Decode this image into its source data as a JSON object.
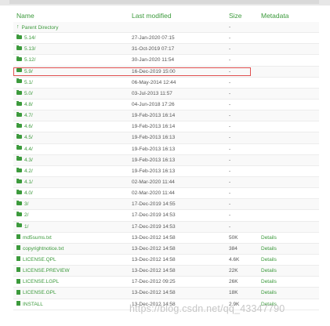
{
  "columns": {
    "name": "Name",
    "modified": "Last modified",
    "size": "Size",
    "metadata": "Metadata"
  },
  "rows": [
    {
      "icon": "up-arrow-icon",
      "name": "Parent Directory",
      "modified": "",
      "size": "-",
      "meta": ""
    },
    {
      "icon": "folder-icon",
      "name": "5.14/",
      "modified": "27-Jan-2020 07:15",
      "size": "-",
      "meta": ""
    },
    {
      "icon": "folder-icon",
      "name": "5.13/",
      "modified": "31-Oct-2019 07:17",
      "size": "-",
      "meta": ""
    },
    {
      "icon": "folder-icon",
      "name": "5.12/",
      "modified": "30-Jan-2020 11:54",
      "size": "-",
      "meta": ""
    },
    {
      "icon": "folder-icon",
      "name": "5.9/",
      "modified": "16-Dec-2019 15:00",
      "size": "-",
      "meta": ""
    },
    {
      "icon": "folder-icon",
      "name": "5.1/",
      "modified": "06-May-2014 12:44",
      "size": "-",
      "meta": ""
    },
    {
      "icon": "folder-icon",
      "name": "5.0/",
      "modified": "03-Jul-2013 11:57",
      "size": "-",
      "meta": ""
    },
    {
      "icon": "folder-icon",
      "name": "4.8/",
      "modified": "04-Jun-2018 17:26",
      "size": "-",
      "meta": ""
    },
    {
      "icon": "folder-icon",
      "name": "4.7/",
      "modified": "19-Feb-2013 16:14",
      "size": "-",
      "meta": ""
    },
    {
      "icon": "folder-icon",
      "name": "4.6/",
      "modified": "19-Feb-2013 16:14",
      "size": "-",
      "meta": ""
    },
    {
      "icon": "folder-icon",
      "name": "4.5/",
      "modified": "19-Feb-2013 16:13",
      "size": "-",
      "meta": ""
    },
    {
      "icon": "folder-icon",
      "name": "4.4/",
      "modified": "19-Feb-2013 16:13",
      "size": "-",
      "meta": ""
    },
    {
      "icon": "folder-icon",
      "name": "4.3/",
      "modified": "19-Feb-2013 16:13",
      "size": "-",
      "meta": ""
    },
    {
      "icon": "folder-icon",
      "name": "4.2/",
      "modified": "19-Feb-2013 16:13",
      "size": "-",
      "meta": ""
    },
    {
      "icon": "folder-icon",
      "name": "4.1/",
      "modified": "02-Mar-2020 11:44",
      "size": "-",
      "meta": ""
    },
    {
      "icon": "folder-icon",
      "name": "4.0/",
      "modified": "02-Mar-2020 11:44",
      "size": "-",
      "meta": ""
    },
    {
      "icon": "folder-icon",
      "name": "3/",
      "modified": "17-Dec-2019 14:55",
      "size": "-",
      "meta": ""
    },
    {
      "icon": "folder-icon",
      "name": "2/",
      "modified": "17-Dec-2019 14:53",
      "size": "-",
      "meta": ""
    },
    {
      "icon": "folder-icon",
      "name": "1/",
      "modified": "17-Dec-2019 14:53",
      "size": "-",
      "meta": ""
    },
    {
      "icon": "file-icon",
      "name": "md5sums.txt",
      "modified": "13-Dec-2012 14:58",
      "size": "50K",
      "meta": "Details"
    },
    {
      "icon": "file-icon",
      "name": "copyrightnotice.txt",
      "modified": "13-Dec-2012 14:58",
      "size": "384",
      "meta": "Details"
    },
    {
      "icon": "file-icon",
      "name": "LICENSE.QPL",
      "modified": "13-Dec-2012 14:58",
      "size": "4.6K",
      "meta": "Details"
    },
    {
      "icon": "file-icon",
      "name": "LICENSE.PREVIEW",
      "modified": "13-Dec-2012 14:58",
      "size": "22K",
      "meta": "Details"
    },
    {
      "icon": "file-icon",
      "name": "LICENSE.LGPL",
      "modified": "17-Dec-2012 09:25",
      "size": "26K",
      "meta": "Details"
    },
    {
      "icon": "file-icon",
      "name": "LICENSE.GPL",
      "modified": "13-Dec-2012 14:58",
      "size": "18K",
      "meta": "Details"
    },
    {
      "icon": "file-icon",
      "name": "INSTALL",
      "modified": "13-Dec-2012 14:58",
      "size": "2.9K",
      "meta": "Details"
    }
  ],
  "highlighted_row": "5.9/",
  "watermark": "https://blog.csdn.net/qq_43347790",
  "colors": {
    "link": "#3c9a3c",
    "highlight_border": "#e05050"
  }
}
